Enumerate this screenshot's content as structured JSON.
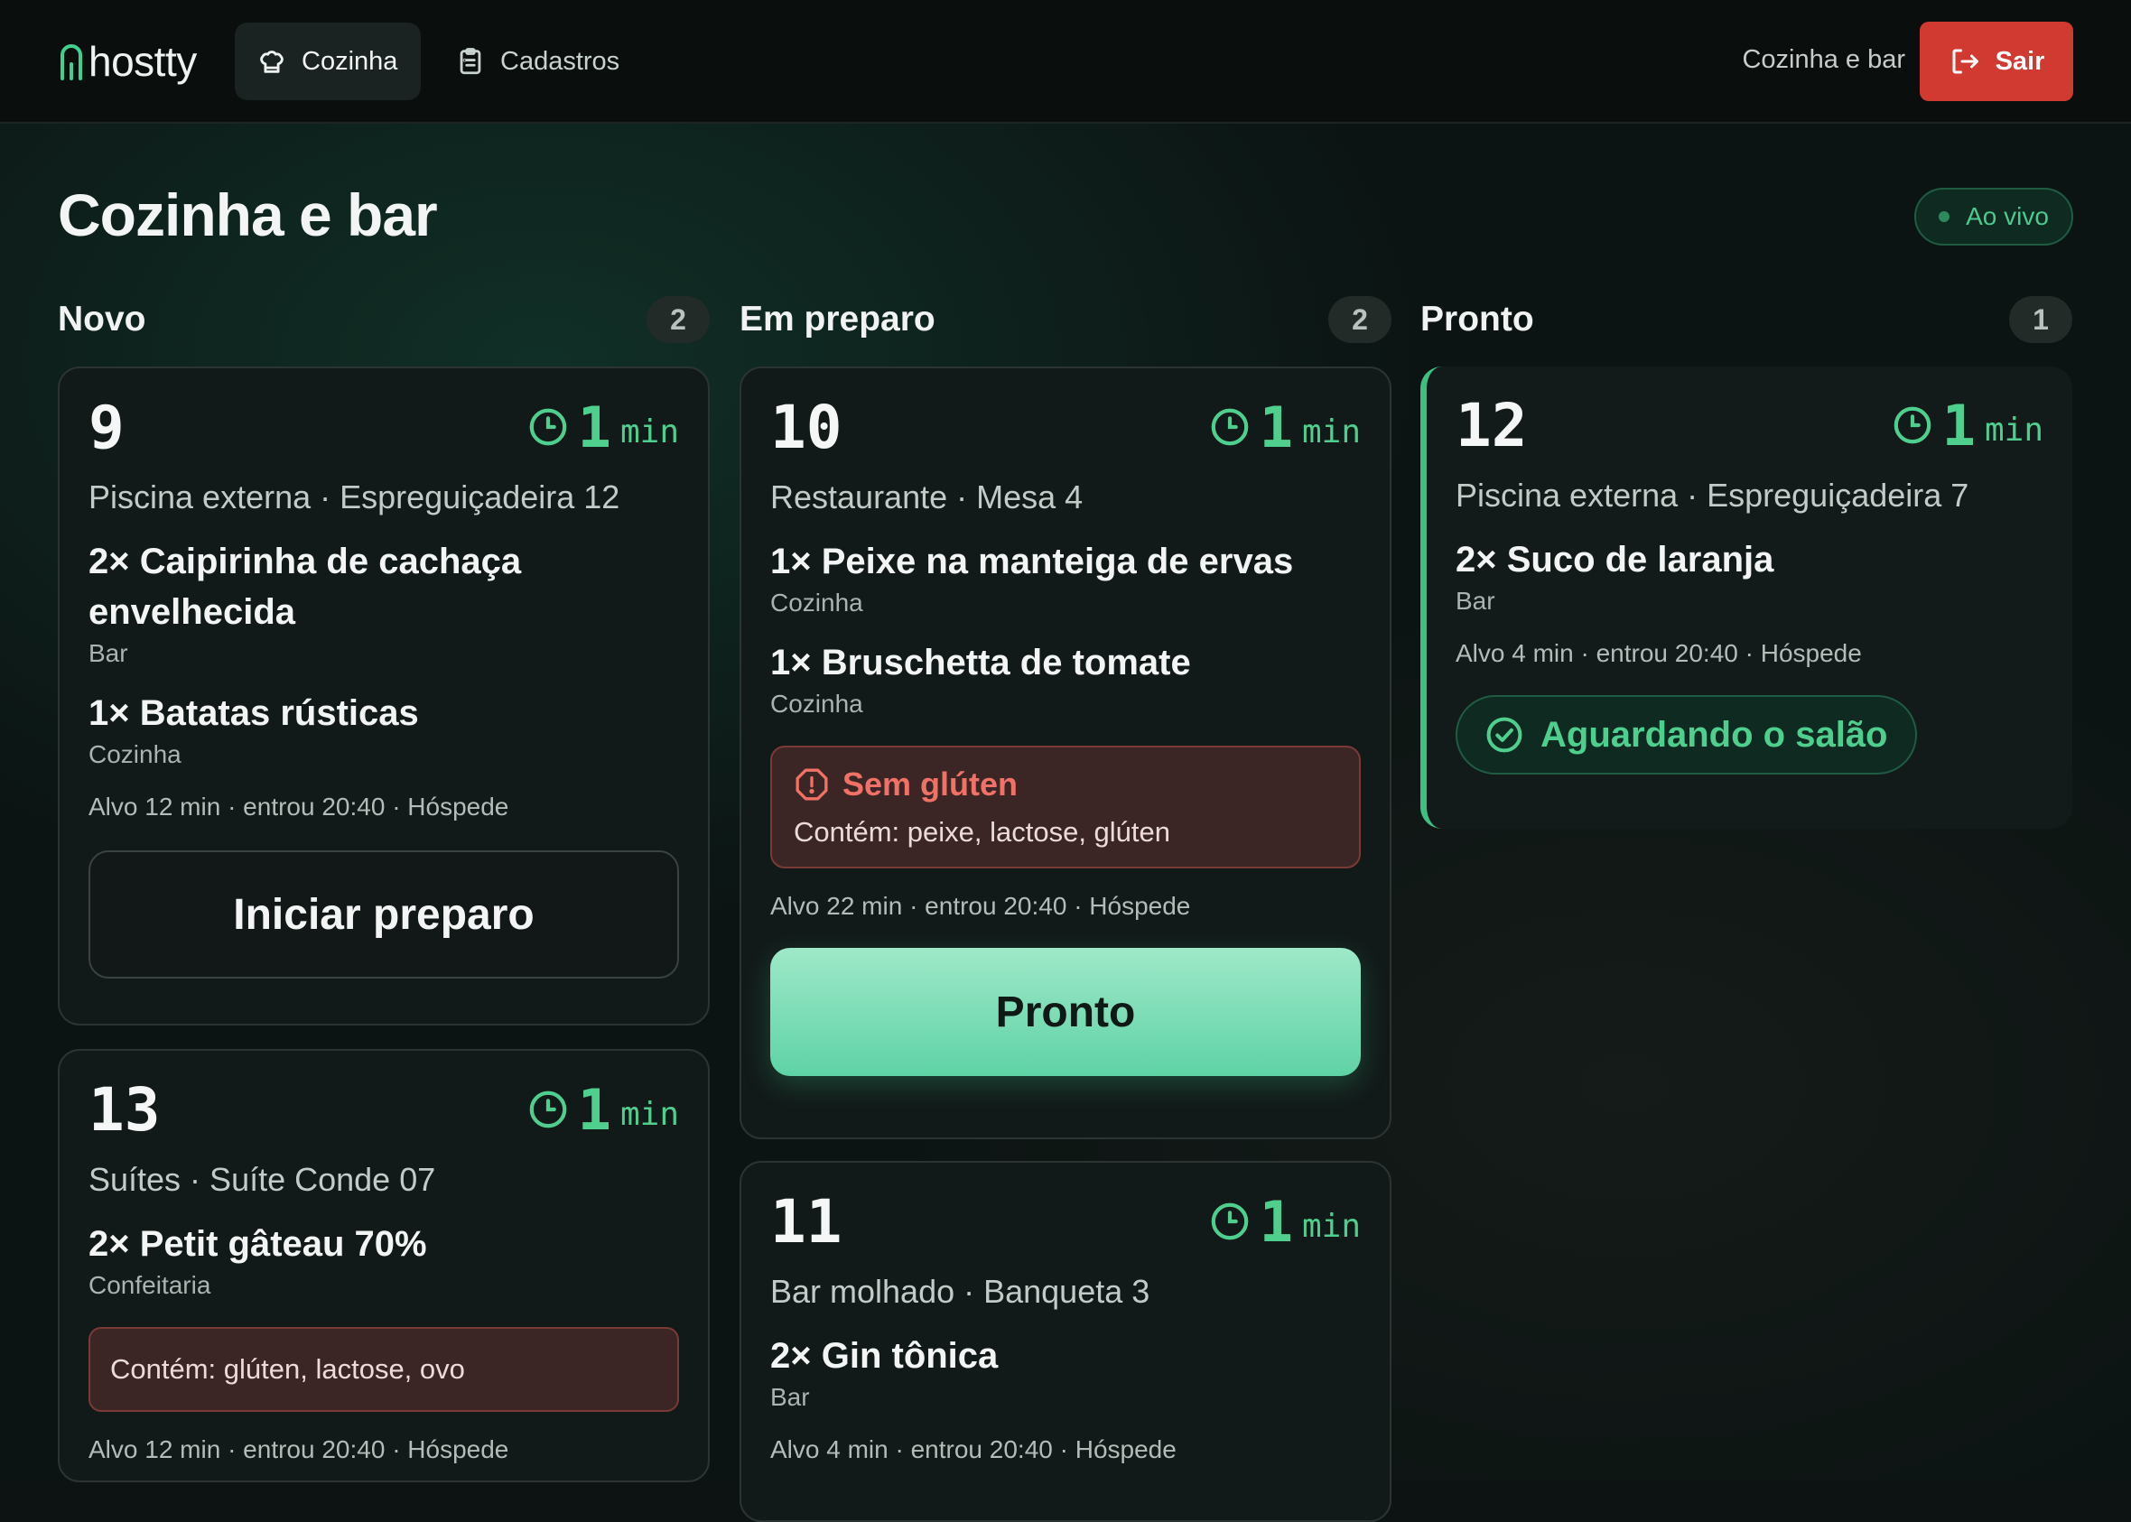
{
  "app": {
    "logo_text": "hostty"
  },
  "nav": {
    "kitchen_label": "Cozinha",
    "registry_label": "Cadastros",
    "context_label": "Cozinha e bar",
    "exit_label": "Sair"
  },
  "page": {
    "title": "Cozinha e bar",
    "live_label": "Ao vivo"
  },
  "colors": {
    "accent": "#4fcf8e",
    "danger": "#d03a31",
    "background": "#0c1413"
  },
  "columns": {
    "novo": {
      "title": "Novo",
      "count": "2",
      "cards": [
        {
          "number": "9",
          "timer_value": "1",
          "timer_unit": "min",
          "location": "Piscina externa · Espreguiçadeira 12",
          "items": [
            {
              "name": "2× Caipirinha de cachaça envelhecida",
              "station": "Bar"
            },
            {
              "name": "1× Batatas rústicas",
              "station": "Cozinha"
            }
          ],
          "meta": "Alvo 12 min · entrou 20:40 · Hóspede",
          "action": "Iniciar preparo"
        },
        {
          "number": "13",
          "timer_value": "1",
          "timer_unit": "min",
          "location": "Suítes · Suíte Conde 07",
          "items": [
            {
              "name": "2× Petit gâteau 70%",
              "station": "Confeitaria"
            }
          ],
          "contains": "Contém: glúten, lactose, ovo",
          "meta": "Alvo 12 min · entrou 20:40 · Hóspede"
        }
      ]
    },
    "prep": {
      "title": "Em preparo",
      "count": "2",
      "cards": [
        {
          "number": "10",
          "timer_value": "1",
          "timer_unit": "min",
          "location": "Restaurante · Mesa 4",
          "items": [
            {
              "name": "1× Peixe na manteiga de ervas",
              "station": "Cozinha"
            },
            {
              "name": "1× Bruschetta de tomate",
              "station": "Cozinha"
            }
          ],
          "allergy_title": "Sem glúten",
          "allergy_text": "Contém: peixe, lactose, glúten",
          "meta": "Alvo 22 min · entrou 20:40 · Hóspede",
          "action": "Pronto"
        },
        {
          "number": "11",
          "timer_value": "1",
          "timer_unit": "min",
          "location": "Bar molhado · Banqueta 3",
          "items": [
            {
              "name": "2× Gin tônica",
              "station": "Bar"
            }
          ],
          "meta": "Alvo 4 min · entrou 20:40 · Hóspede"
        }
      ]
    },
    "pronto": {
      "title": "Pronto",
      "count": "1",
      "cards": [
        {
          "number": "12",
          "timer_value": "1",
          "timer_unit": "min",
          "location": "Piscina externa · Espreguiçadeira 7",
          "items": [
            {
              "name": "2× Suco de laranja",
              "station": "Bar"
            }
          ],
          "meta": "Alvo 4 min · entrou 20:40 · Hóspede",
          "status": "Aguardando o salão"
        }
      ]
    }
  }
}
